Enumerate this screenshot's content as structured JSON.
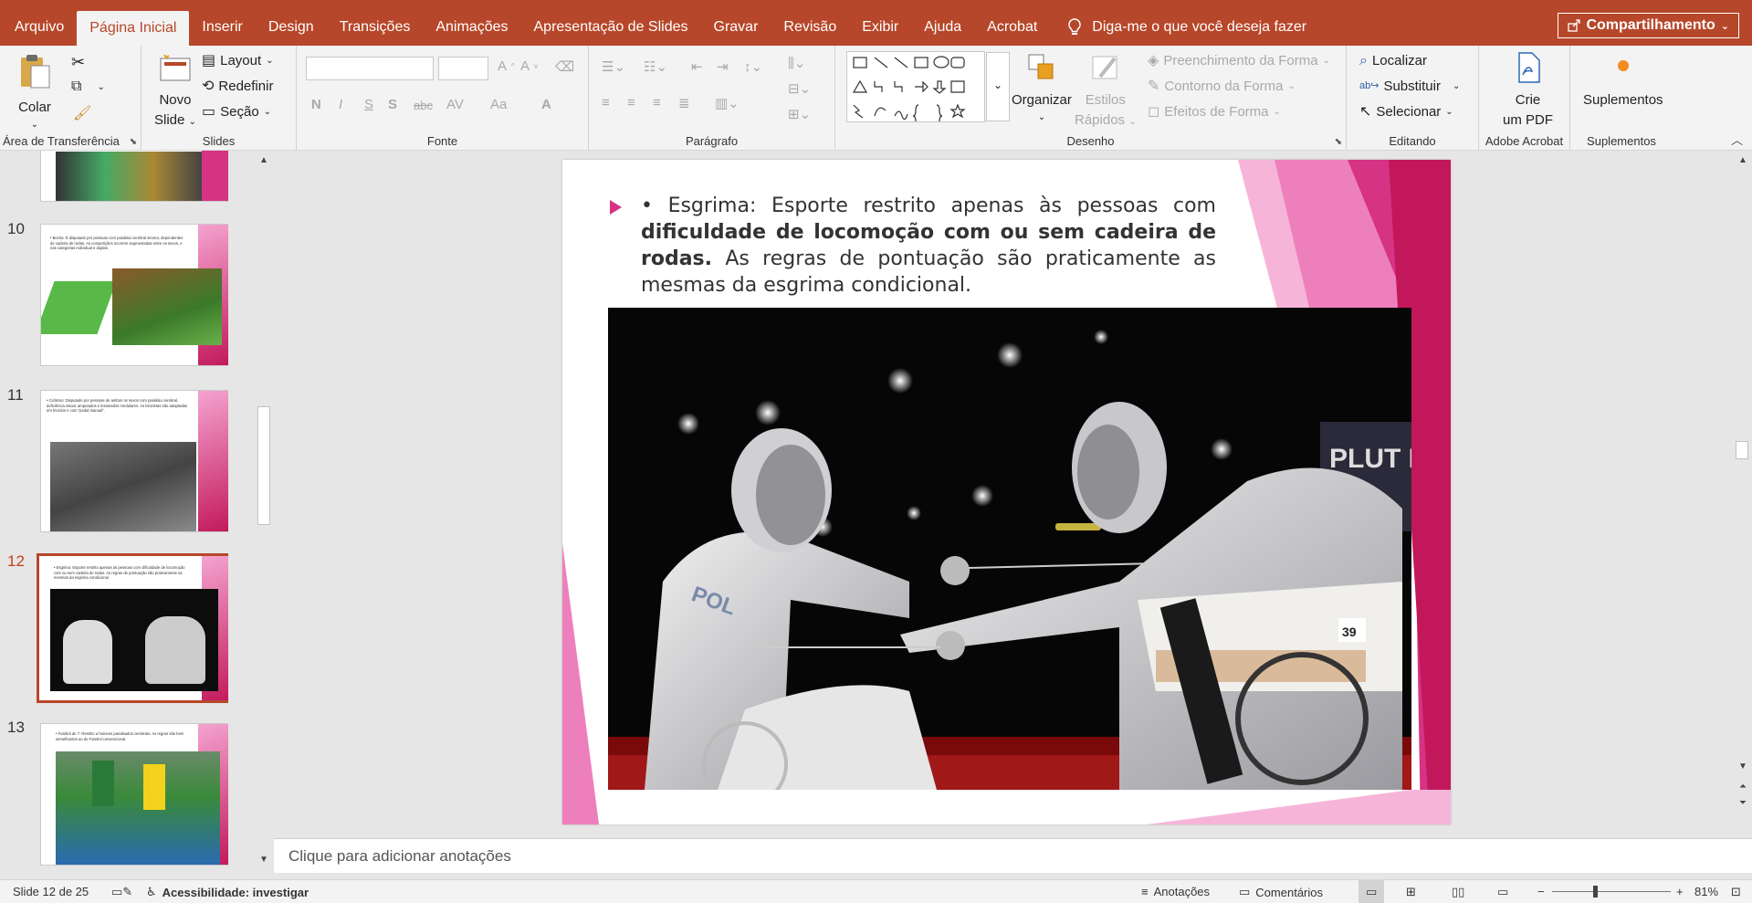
{
  "tabs": [
    "Arquivo",
    "Página Inicial",
    "Inserir",
    "Design",
    "Transições",
    "Animações",
    "Apresentação de Slides",
    "Gravar",
    "Revisão",
    "Exibir",
    "Ajuda",
    "Acrobat"
  ],
  "active_tab": "Página Inicial",
  "tell_me": "Diga-me o que você deseja fazer",
  "share": "Compartilhamento",
  "ribbon": {
    "clipboard": {
      "paste": "Colar",
      "label": "Área de Transferência"
    },
    "slides": {
      "new_slide_1": "Novo",
      "new_slide_2": "Slide",
      "layout": "Layout",
      "reset": "Redefinir",
      "section": "Seção",
      "label": "Slides"
    },
    "font": {
      "bold": "N",
      "italic": "I",
      "underline": "S",
      "shadow": "S",
      "strike": "abc",
      "spacing": "AV",
      "case": "Aa",
      "color": "A",
      "label": "Fonte"
    },
    "paragraph": {
      "label": "Parágrafo"
    },
    "drawing": {
      "arrange": "Organizar",
      "quick_styles_1": "Estilos",
      "quick_styles_2": "Rápidos",
      "fill": "Preenchimento da Forma",
      "outline": "Contorno da Forma",
      "effects": "Efeitos de Forma",
      "label": "Desenho"
    },
    "editing": {
      "find": "Localizar",
      "replace": "Substituir",
      "select": "Selecionar",
      "label": "Editando"
    },
    "acrobat": {
      "create_1": "Crie",
      "create_2": "um PDF",
      "label": "Adobe Acrobat"
    },
    "addins": {
      "addins": "Suplementos",
      "label": "Suplementos"
    }
  },
  "thumbnails": [
    {
      "num": "10",
      "text": "• Bocha: É disputado por pessoas com paralisia cerebral severa, dependentes de cadeira de rodas. As competições ocorrem segmentadas entre os sexos, e nas categorias individual e duplas."
    },
    {
      "num": "11",
      "text": "• Ciclismo: Disputado por pessoas de ambos os sexos com paralisia cerebral, deficiência visual, amputados e lesionados medulares. As bicicletas são adaptadas em triciclos e com \"pedal manual\"."
    },
    {
      "num": "12",
      "text": "• Esgrima: Esporte restrito apenas às pessoas com dificuldade de locomoção com ou sem cadeira de rodas. As regras de pontuação são praticamente as mesmas da esgrima condicional."
    },
    {
      "num": "13",
      "text": "• Futebol de 7: Restrito a homens paralisados cerebrais. As regras são bem semelhantes ao do Futebol convencional."
    }
  ],
  "slide": {
    "text_normal_1": "• Esgrima: Esporte restrito apenas às pessoas com ",
    "text_bold": "dificuldade de locomoção com ou sem cadeira de rodas.",
    "text_normal_2": " As regras de pontuação são praticamente as mesmas da esgrima condicional.",
    "photo_label": "PLUT POL",
    "fencer_left": "POL",
    "number_tag": "39"
  },
  "notes_placeholder": "Clique para adicionar anotações",
  "status": {
    "slide_count": "Slide 12 de 25",
    "accessibility": "Acessibilidade: investigar",
    "notes": "Anotações",
    "comments": "Comentários",
    "zoom": "81%"
  },
  "colors": {
    "accent": "#b7472a",
    "pink": "#d63384",
    "magenta": "#c2185b"
  }
}
